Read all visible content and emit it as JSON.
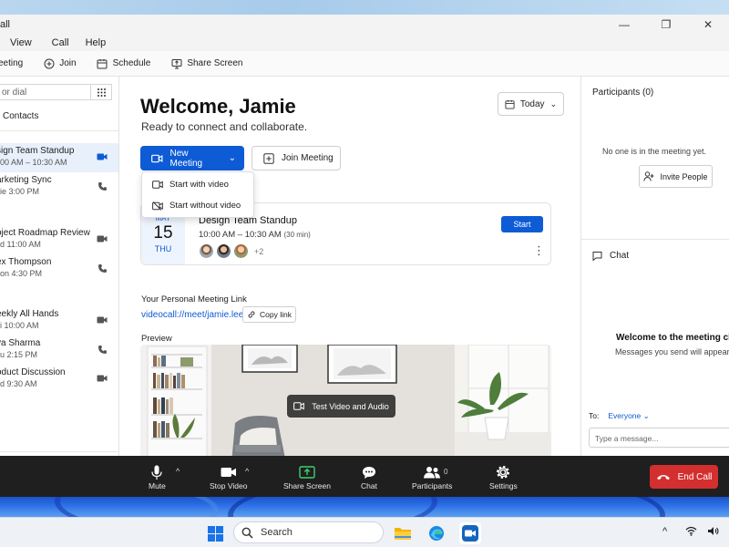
{
  "window": {
    "title": "all",
    "controls": [
      "—",
      "❐",
      "✕"
    ]
  },
  "menu": [
    "View",
    "Call",
    "Help"
  ],
  "toolbar": {
    "items": [
      {
        "label": "eeting",
        "icon": "none"
      },
      {
        "label": "Join",
        "icon": "plus-circle-icon"
      },
      {
        "label": "Schedule",
        "icon": "calendar-icon"
      },
      {
        "label": "Share Screen",
        "icon": "share-screen-icon"
      }
    ]
  },
  "sidebar": {
    "search_placeholder": "or dial",
    "contacts_label": "Contacts",
    "items": [
      {
        "title": "sign Team Standup",
        "sub": "00 AM – 10:30 AM",
        "icon": "video",
        "active": true
      },
      {
        "title": "arketing Sync",
        "sub": "ie 3:00 PM",
        "icon": "phone"
      },
      {
        "title": "oject Roadmap Review",
        "sub": "d 11:00 AM",
        "icon": "video"
      },
      {
        "title": "ex Thompson",
        "sub": "on 4:30 PM",
        "icon": "phone"
      },
      {
        "title": "eekly All Hands",
        "sub": "i 10:00 AM",
        "icon": "video"
      },
      {
        "title": "ya Sharma",
        "sub": "u 2:15 PM",
        "icon": "phone"
      },
      {
        "title": "oduct Discussion",
        "sub": "d 9:30 AM",
        "icon": "video"
      }
    ]
  },
  "main": {
    "welcome": "Welcome, Jamie",
    "subtitle": "Ready to connect and collaborate.",
    "today_label": "Today",
    "new_meeting_label": "New Meeting",
    "join_meeting_label": "Join Meeting",
    "dropdown": [
      "Start with video",
      "Start without video"
    ],
    "meeting": {
      "month": "MAY",
      "day": "15",
      "weekday": "THU",
      "title": "Design Team Standup",
      "time": "10:00 AM – 10:30 AM",
      "duration": "(30 min)",
      "more": "+2",
      "start_label": "Start"
    },
    "pml_label": "Your Personal Meeting Link",
    "pml_link": "videocall://meet/jamie.lee",
    "copy_label": "Copy link",
    "preview_label": "Preview",
    "test_label": "Test Video and Audio"
  },
  "right": {
    "participants_title": "Participants (0)",
    "empty_text": "No one is in the meeting yet.",
    "invite_label": "Invite People",
    "chat_title": "Chat",
    "chat_welcome": "Welcome to the meeting chat!",
    "chat_sub": "Messages you send will appear here",
    "to_label": "To:",
    "to_value": "Everyone",
    "msg_placeholder": "Type a message..."
  },
  "meetbar": {
    "mute": "Mute",
    "stop_video": "Stop Video",
    "share": "Share Screen",
    "chat": "Chat",
    "participants": "Participants",
    "participants_count": "0",
    "settings": "Settings",
    "end_call": "End Call"
  },
  "taskbar": {
    "search_label": "Search"
  },
  "colors": {
    "accent": "#0e5bd6",
    "end": "#d32f2f",
    "meetbar": "#1f1f1f"
  }
}
